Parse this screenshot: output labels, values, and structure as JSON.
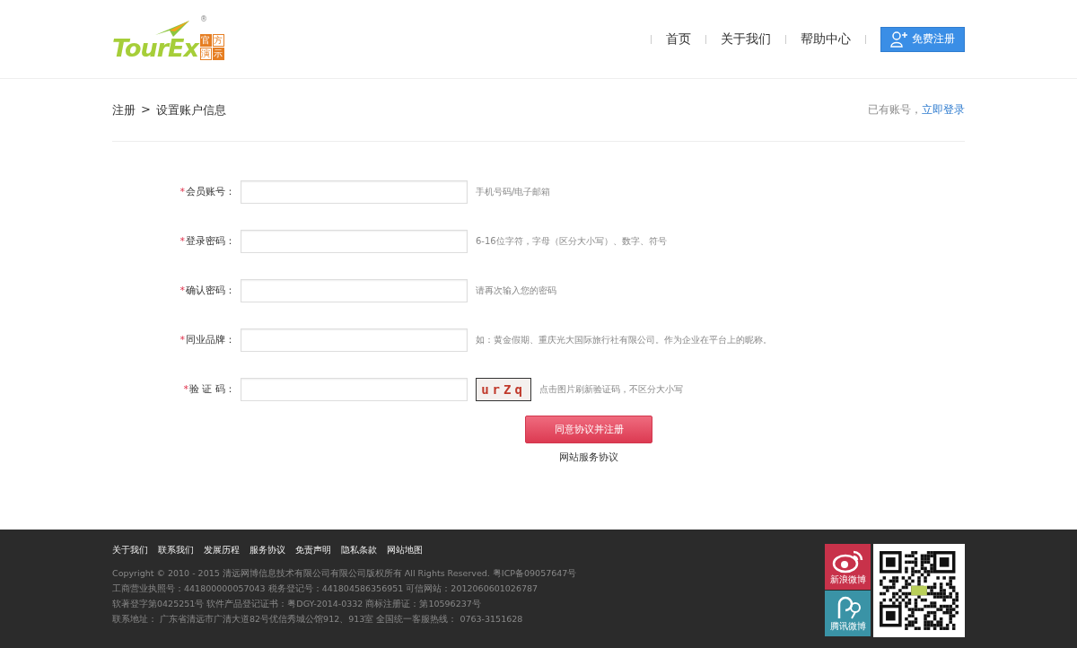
{
  "header": {
    "logo": {
      "text": "TourEx",
      "badge": [
        "官",
        "方",
        "演",
        "示"
      ],
      "mark": "®"
    },
    "nav": [
      {
        "label": "首页"
      },
      {
        "label": "关于我们"
      },
      {
        "label": "帮助中心"
      }
    ],
    "register_button": "免费注册"
  },
  "breadcrumb": {
    "items": [
      "注册",
      "设置账户信息"
    ],
    "separator": ">"
  },
  "login_prompt": {
    "text": "已有账号，",
    "link": "立即登录"
  },
  "form": {
    "required_mark": "*",
    "fields": [
      {
        "kind": "text",
        "label": "会员账号：",
        "required": true,
        "hint": "手机号码/电子邮箱"
      },
      {
        "kind": "text",
        "label": "登录密码：",
        "required": true,
        "hint": "6-16位字符，字母（区分大小写）、数字、符号"
      },
      {
        "kind": "text",
        "label": "确认密码：",
        "required": true,
        "hint": "请再次输入您的密码"
      },
      {
        "kind": "text",
        "label": "同业品牌：",
        "required": true,
        "hint": "如：黄金假期、重庆光大国际旅行社有限公司。作为企业在平台上的昵称。"
      },
      {
        "kind": "captcha",
        "label": "验 证 码：",
        "required": true,
        "captcha": "urZq",
        "hint": "点击图片刷新验证码，不区分大小写"
      }
    ],
    "submit": "同意协议并注册",
    "agreement_link": "网站服务协议"
  },
  "footer": {
    "links": [
      "关于我们",
      "联系我们",
      "发展历程",
      "服务协议",
      "免责声明",
      "隐私条款",
      "网站地图"
    ],
    "lines": [
      "Copyright © 2010 - 2015 清远网博信息技术有限公司有限公司版权所有 All Rights Reserved. 粤ICP备09057647号",
      "工商营业执照号：441800000057043 税务登记号：441804586356951 可信网站：2012060601026787",
      "软著登字第0425251号 软件产品登记证书：粤DGY-2014-0332 商标注册证：第10596237号",
      "联系地址： 广东省清远市广清大道82号优信秀城公馆912、913室 全国统一客服热线： 0763-3151628"
    ],
    "social": [
      {
        "kind": "weibo",
        "label": "新浪微博",
        "color": "#c8324a"
      },
      {
        "kind": "tencent",
        "label": "腾讯微博",
        "color": "#3a93a6"
      }
    ]
  }
}
